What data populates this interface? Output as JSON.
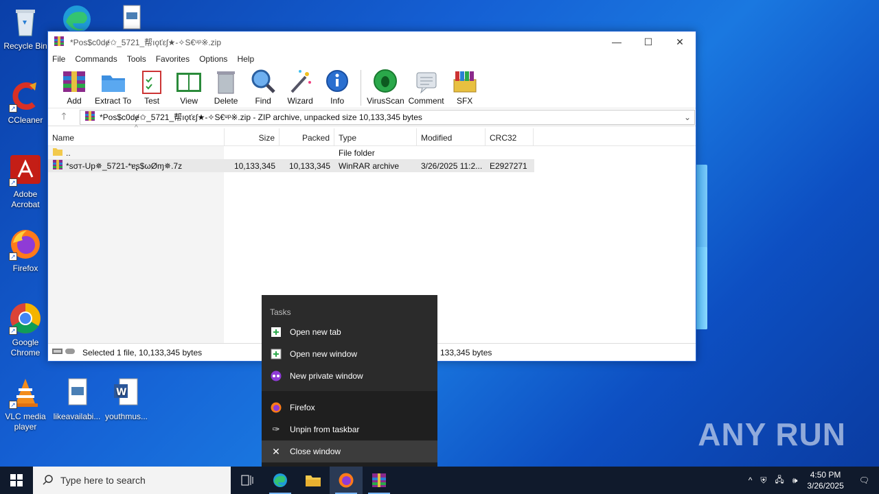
{
  "desktop": {
    "icons": [
      {
        "label": "Recycle Bin"
      },
      {
        "label": "CCleaner"
      },
      {
        "label": "Adobe Acrobat"
      },
      {
        "label": "Firefox"
      },
      {
        "label": "Google Chrome"
      },
      {
        "label": "VLC media player"
      },
      {
        "label": "likeavailabi..."
      },
      {
        "label": "youthmus..."
      }
    ]
  },
  "window": {
    "title": "*Pᴏѕ$c0dɇ✩_5721_帮ıǫťεʃ★-✧S€ᵘᵖ※.zip",
    "menu": [
      "File",
      "Commands",
      "Tools",
      "Favorites",
      "Options",
      "Help"
    ],
    "toolbar": [
      "Add",
      "Extract To",
      "Test",
      "View",
      "Delete",
      "Find",
      "Wizard",
      "Info",
      "VirusScan",
      "Comment",
      "SFX"
    ],
    "address": "*Pᴏѕ$c0dɇ✩_5721_帮ıǫťεʃ★-✧S€ᵘᵖ※.zip - ZIP archive, unpacked size 10,133,345 bytes",
    "columns": {
      "name": "Name",
      "size": "Size",
      "packed": "Packed",
      "type": "Type",
      "modified": "Modified",
      "crc": "CRC32"
    },
    "rows": [
      {
        "name": "..",
        "size": "",
        "packed": "",
        "type": "File folder",
        "modified": "",
        "crc": ""
      },
      {
        "name": "*ѕσт-Up✵_5721-*ɐʂ$ωØɱ✵.7z",
        "size": "10,133,345",
        "packed": "10,133,345",
        "type": "WinRAR archive",
        "modified": "3/26/2025 11:2...",
        "crc": "E2927271"
      }
    ],
    "status_left": "Selected 1 file, 10,133,345 bytes",
    "status_right": "133,345 bytes"
  },
  "context_menu": {
    "section_title": "Tasks",
    "tasks": [
      "Open new tab",
      "Open new window",
      "New private window"
    ],
    "app_items": [
      "Firefox",
      "Unpin from taskbar",
      "Close window"
    ]
  },
  "taskbar": {
    "search_placeholder": "Type here to search",
    "time": "4:50 PM",
    "date": "3/26/2025"
  },
  "watermark": "ANY RUN"
}
